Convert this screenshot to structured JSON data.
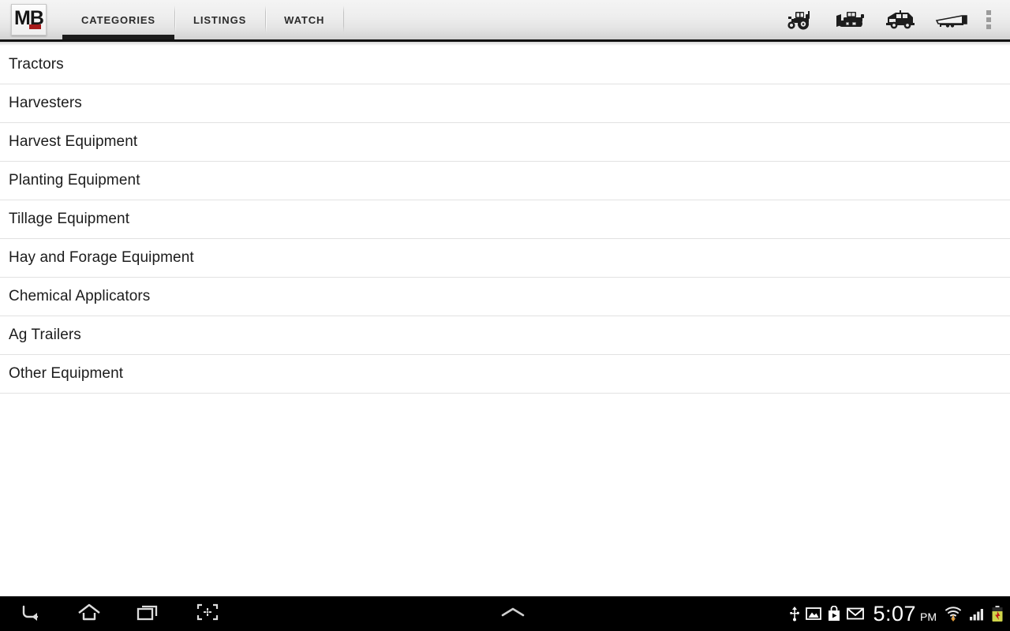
{
  "app": {
    "logo_text": "MB",
    "logo_accent_color": "#a81b1b"
  },
  "action_bar": {
    "tabs": [
      {
        "label": "CATEGORIES",
        "active": true
      },
      {
        "label": "LISTINGS",
        "active": false
      },
      {
        "label": "WATCH",
        "active": false
      }
    ],
    "actions": [
      {
        "name": "tractor-icon",
        "label": "Tractor"
      },
      {
        "name": "dozer-icon",
        "label": "Dozer"
      },
      {
        "name": "truck-icon",
        "label": "Truck"
      },
      {
        "name": "trailer-icon",
        "label": "Trailer"
      }
    ],
    "overflow_label": "More options",
    "indicator_color": "#1b1b1b"
  },
  "categories": {
    "items": [
      {
        "label": "Tractors"
      },
      {
        "label": "Harvesters"
      },
      {
        "label": "Harvest Equipment"
      },
      {
        "label": "Planting Equipment"
      },
      {
        "label": "Tillage Equipment"
      },
      {
        "label": "Hay and Forage Equipment"
      },
      {
        "label": "Chemical Applicators"
      },
      {
        "label": "Ag Trailers"
      },
      {
        "label": "Other Equipment"
      }
    ]
  },
  "system_nav": {
    "buttons": [
      {
        "name": "back-icon",
        "label": "Back"
      },
      {
        "name": "home-icon",
        "label": "Home"
      },
      {
        "name": "recents-icon",
        "label": "Recent apps"
      },
      {
        "name": "screenshot-icon",
        "label": "Screenshot"
      }
    ],
    "handle_label": "Notifications",
    "status": {
      "icons": [
        {
          "name": "usb-icon",
          "label": "USB connected"
        },
        {
          "name": "screenshot-captured-icon",
          "label": "Screenshot captured"
        },
        {
          "name": "play-store-icon",
          "label": "Play Store"
        },
        {
          "name": "gmail-icon",
          "label": "Gmail"
        }
      ],
      "time": "5:07",
      "ampm": "PM",
      "trailing_icons": [
        {
          "name": "wifi-icon",
          "label": "Wi-Fi"
        },
        {
          "name": "signal-icon",
          "label": "Cellular signal"
        },
        {
          "name": "battery-warning-icon",
          "label": "Battery"
        }
      ]
    }
  }
}
